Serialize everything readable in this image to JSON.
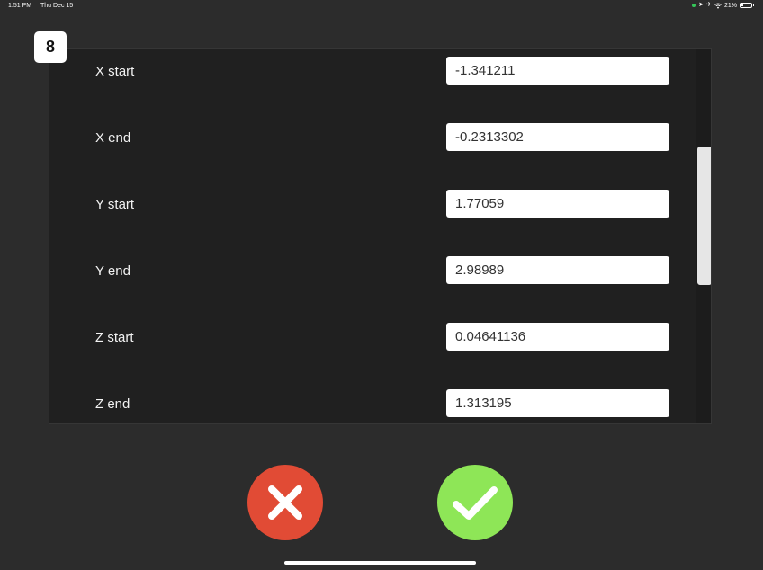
{
  "status_bar": {
    "time": "1:51 PM",
    "date": "Thu Dec 15",
    "battery_text": "21%",
    "battery_level": 0.21
  },
  "badge": {
    "number": "8"
  },
  "fields": [
    {
      "label": "X start",
      "value": "-1.341211"
    },
    {
      "label": "X end",
      "value": "-0.2313302"
    },
    {
      "label": "Y start",
      "value": "1.77059"
    },
    {
      "label": "Y end",
      "value": "2.98989"
    },
    {
      "label": "Z start",
      "value": "0.04641136"
    },
    {
      "label": "Z end",
      "value": "1.313195"
    }
  ],
  "actions": {
    "cancel_icon": "close-icon",
    "confirm_icon": "checkmark-icon"
  },
  "colors": {
    "cancel": "#e14b35",
    "confirm": "#8ee657",
    "background": "#2c2c2c",
    "panel": "#202020"
  }
}
